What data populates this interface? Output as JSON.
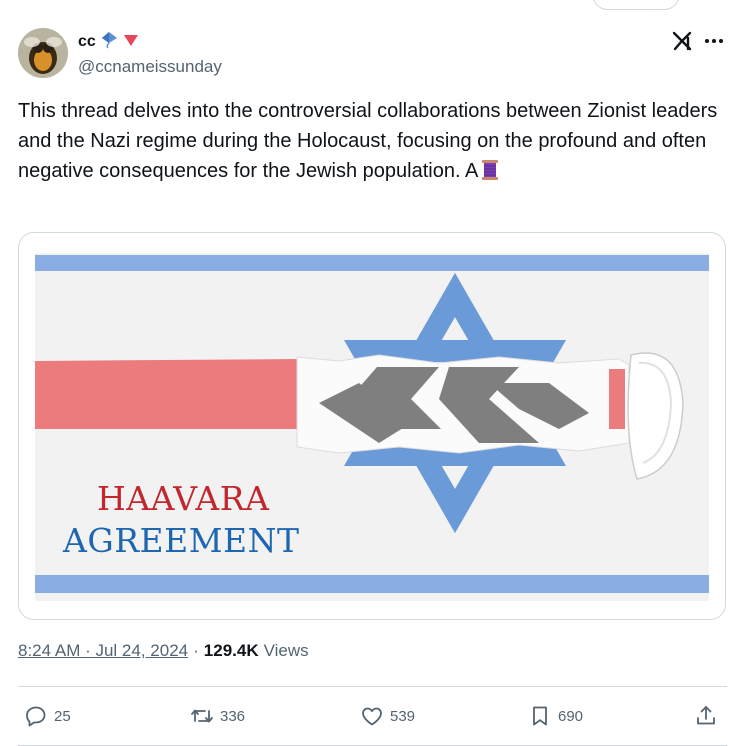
{
  "author": {
    "display_name": "cc",
    "handle": "@ccnameissunday"
  },
  "tweet": {
    "text": "This thread delves into the controversial collaborations between Zionist leaders and the Nazi regime during the Holocaust, focusing on the profound and often negative consequences for the Jewish population. A"
  },
  "media": {
    "line1": "HAAVARA",
    "line2": "AGREEMENT"
  },
  "meta": {
    "time": "8:24 AM · Jul 24, 2024",
    "separator": "·",
    "views_count": "129.4K",
    "views_label": "Views"
  },
  "actions": {
    "reply_count": "25",
    "repost_count": "336",
    "like_count": "539",
    "bookmark_count": "690"
  },
  "colors": {
    "text": "#0f1419",
    "secondary": "#536471",
    "border": "#cfd9de",
    "haavara_red": "#c1272d",
    "agreement_blue": "#1f66b0",
    "flag_blue": "#8aaee4"
  },
  "icons": [
    "grok-icon",
    "more-icon",
    "reply-icon",
    "repost-icon",
    "like-icon",
    "bookmark-icon",
    "share-icon",
    "kite-emoji-icon",
    "red-triangle-icon",
    "thread-spool-emoji-icon"
  ]
}
